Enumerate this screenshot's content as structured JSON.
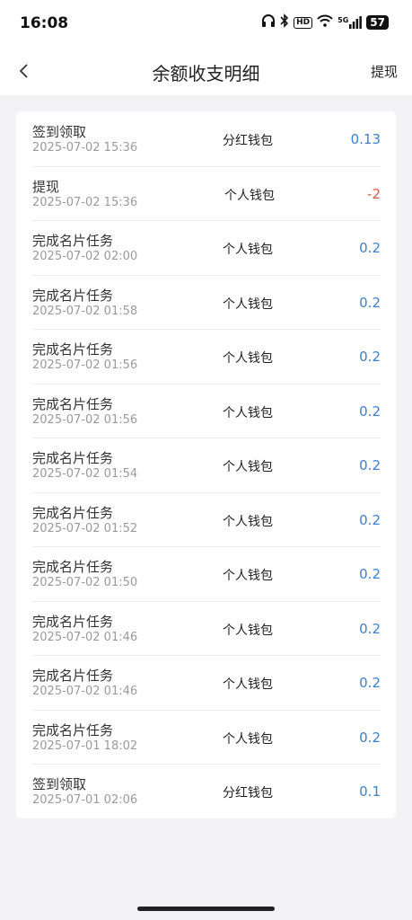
{
  "status_bar": {
    "time": "16:08",
    "network": "5G",
    "battery": "57"
  },
  "nav": {
    "title": "余额收支明细",
    "action": "提现"
  },
  "colors": {
    "positive": "#3d7fd0",
    "negative": "#d65b45"
  },
  "records": [
    {
      "title": "签到领取",
      "time": "2025-07-02 15:36",
      "wallet": "分红钱包",
      "amount": "0.13",
      "sign": "pos"
    },
    {
      "title": "提现",
      "time": "2025-07-02 15:36",
      "wallet": "个人钱包",
      "amount": "-2",
      "sign": "neg"
    },
    {
      "title": "完成名片任务",
      "time": "2025-07-02 02:00",
      "wallet": "个人钱包",
      "amount": "0.2",
      "sign": "pos"
    },
    {
      "title": "完成名片任务",
      "time": "2025-07-02 01:58",
      "wallet": "个人钱包",
      "amount": "0.2",
      "sign": "pos"
    },
    {
      "title": "完成名片任务",
      "time": "2025-07-02 01:56",
      "wallet": "个人钱包",
      "amount": "0.2",
      "sign": "pos"
    },
    {
      "title": "完成名片任务",
      "time": "2025-07-02 01:56",
      "wallet": "个人钱包",
      "amount": "0.2",
      "sign": "pos"
    },
    {
      "title": "完成名片任务",
      "time": "2025-07-02 01:54",
      "wallet": "个人钱包",
      "amount": "0.2",
      "sign": "pos"
    },
    {
      "title": "完成名片任务",
      "time": "2025-07-02 01:52",
      "wallet": "个人钱包",
      "amount": "0.2",
      "sign": "pos"
    },
    {
      "title": "完成名片任务",
      "time": "2025-07-02 01:50",
      "wallet": "个人钱包",
      "amount": "0.2",
      "sign": "pos"
    },
    {
      "title": "完成名片任务",
      "time": "2025-07-02 01:46",
      "wallet": "个人钱包",
      "amount": "0.2",
      "sign": "pos"
    },
    {
      "title": "完成名片任务",
      "time": "2025-07-02 01:46",
      "wallet": "个人钱包",
      "amount": "0.2",
      "sign": "pos"
    },
    {
      "title": "完成名片任务",
      "time": "2025-07-01 18:02",
      "wallet": "个人钱包",
      "amount": "0.2",
      "sign": "pos"
    },
    {
      "title": "签到领取",
      "time": "2025-07-01 02:06",
      "wallet": "分红钱包",
      "amount": "0.1",
      "sign": "pos"
    }
  ]
}
